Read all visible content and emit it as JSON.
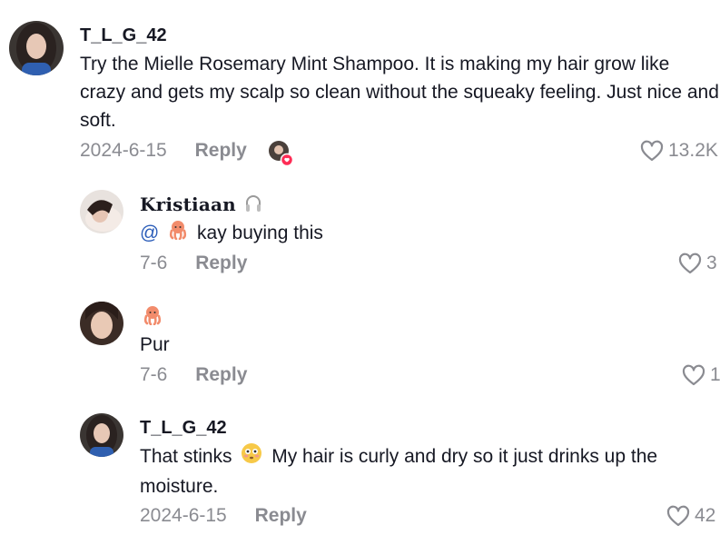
{
  "comments": [
    {
      "username": "T_L_G_42",
      "text": "Try the Mielle Rosemary Mint Shampoo. It is making my hair grow like crazy and gets my scalp so clean without the squeaky feeling. Just nice and soft.",
      "date": "2024-6-15",
      "reply_label": "Reply",
      "likes": "13.2K",
      "creator_liked": true
    }
  ],
  "replies": [
    {
      "username": "Kristiaan",
      "badge_icon": "headphones-icon",
      "mention": "@",
      "mention_emoji": "octopus-icon",
      "text": "kay buying this",
      "date": "7-6",
      "reply_label": "Reply",
      "likes": "3"
    },
    {
      "username_emoji": "octopus-icon",
      "text": "Pur",
      "date": "7-6",
      "reply_label": "Reply",
      "likes": "1"
    },
    {
      "username": "T_L_G_42",
      "text_before": "That stinks",
      "text_emoji": "flushed-face-icon",
      "text_after": "My hair is curly and dry so it just drinks up the moisture.",
      "date": "2024-6-15",
      "reply_label": "Reply",
      "likes": "42"
    }
  ],
  "colors": {
    "muted": "#8a8b91",
    "mention": "#2b5db9",
    "like_badge": "#fe2c55"
  }
}
